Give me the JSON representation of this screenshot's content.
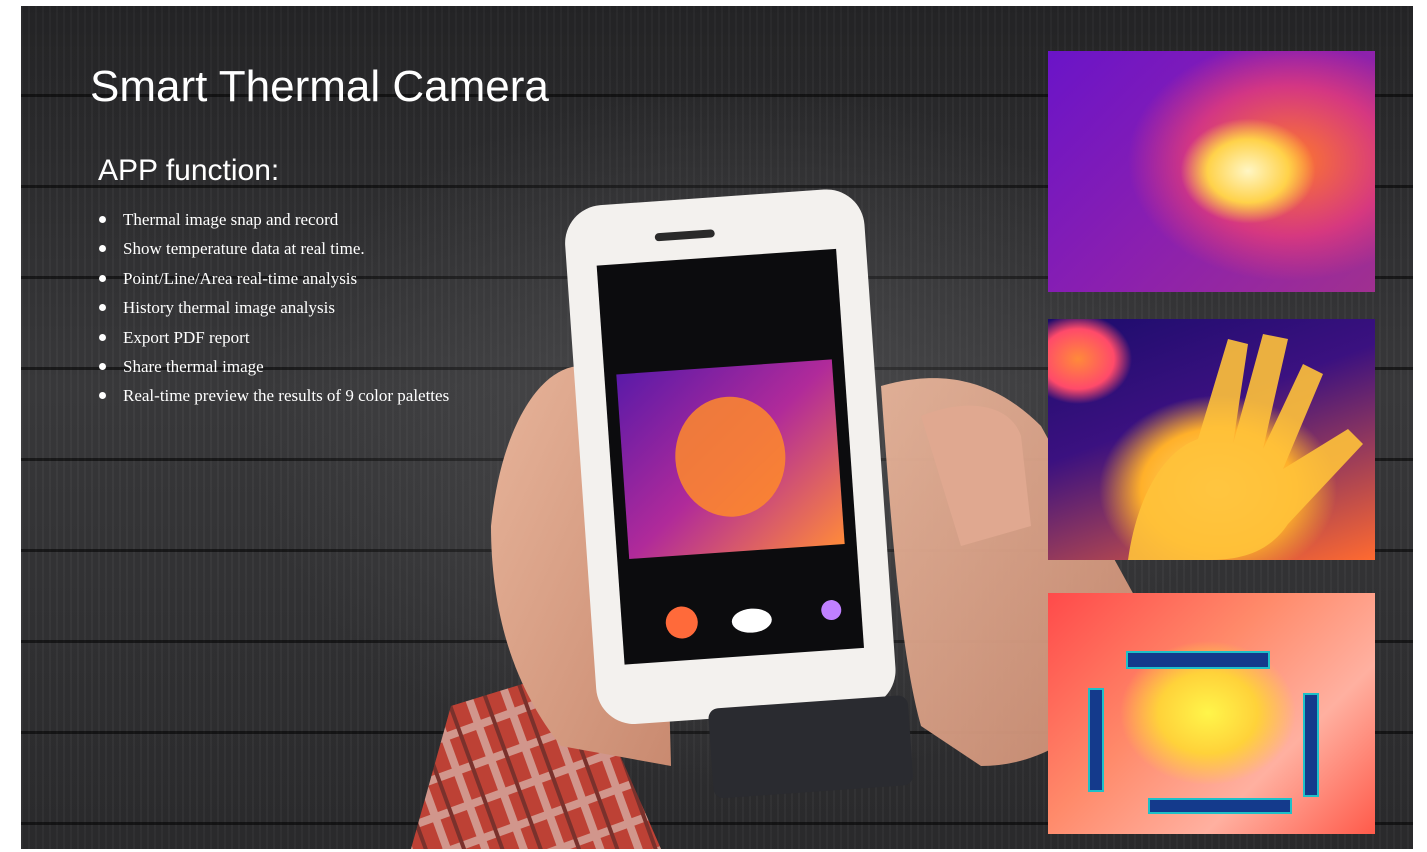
{
  "slide": {
    "title": "Smart Thermal Camera",
    "subtitle": "APP function:",
    "features": [
      "Thermal image snap and record",
      "Show temperature data at real time.",
      "Point/Line/Area real-time analysis",
      "History thermal image analysis",
      "Export PDF report",
      "Share thermal image",
      "Real-time preview the results of  9 color palettes"
    ]
  },
  "images": {
    "thermal_images": [
      "thermal-image-car",
      "thermal-image-hand",
      "thermal-image-rainbow"
    ],
    "photo": "hands-holding-smartphone-with-thermal-camera"
  },
  "colors": {
    "text": "#ffffff",
    "background": "#2e2e30",
    "thermal_purple": "#6a14c8",
    "thermal_yellow": "#ffd24a"
  }
}
